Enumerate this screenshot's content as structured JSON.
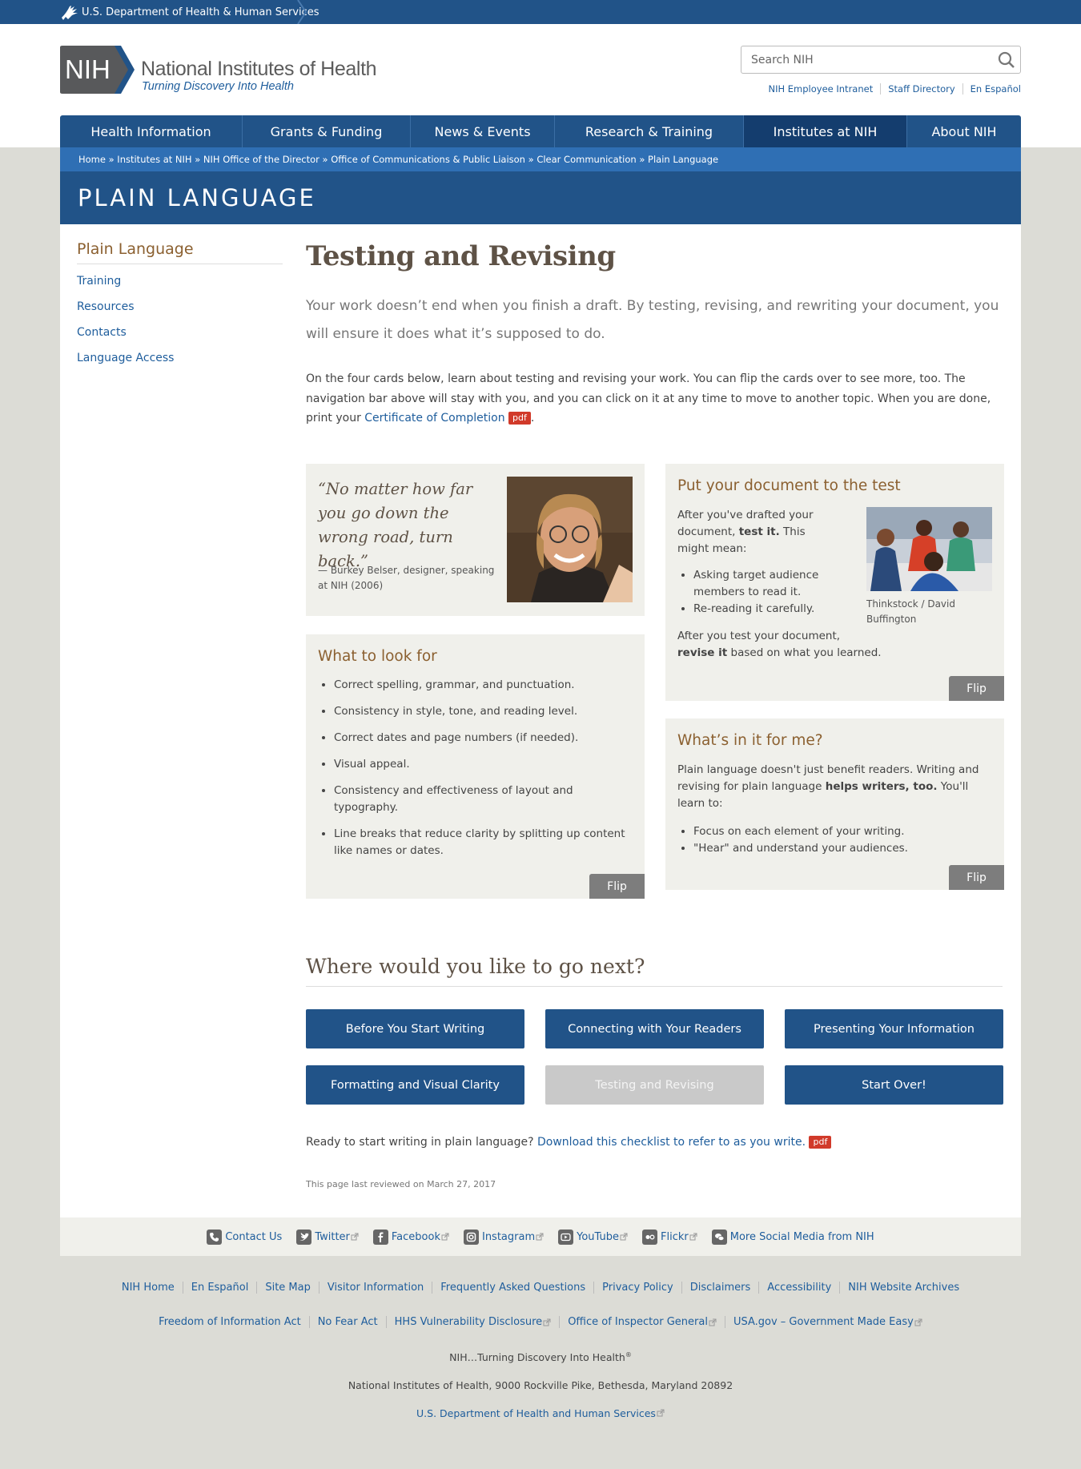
{
  "hhs": {
    "label": "U.S. Department of Health & Human Services"
  },
  "header": {
    "logo_abbr": "NIH",
    "logo_name": "National Institutes of Health",
    "logo_tagline": "Turning Discovery Into Health",
    "search_placeholder": "Search NIH",
    "util_links": [
      "NIH Employee Intranet",
      "Staff Directory",
      "En Español"
    ]
  },
  "nav": {
    "items": [
      "Health Information",
      "Grants & Funding",
      "News & Events",
      "Research & Training",
      "Institutes at NIH",
      "About NIH"
    ],
    "active": "Institutes at NIH"
  },
  "breadcrumb": "Home » Institutes at NIH » NIH Office of the Director » Office of Communications & Public Liaison » Clear Communication » Plain Language",
  "banner": {
    "title": "PLAIN LANGUAGE"
  },
  "sidebar": {
    "title": "Plain Language",
    "items": [
      "Training",
      "Resources",
      "Contacts",
      "Language Access"
    ]
  },
  "page": {
    "title": "Testing and Revising",
    "lead": "Your work doesn’t end when you finish a draft. By testing, revising, and rewriting your document, you will ensure it does what it’s supposed to do.",
    "intro_text": "On the four cards below, learn about testing and revising your work. You can flip the cards over to see more, too. The navigation bar above will stay with you, and you can click on it at any time to move to another topic. When you are done, print your ",
    "intro_link": "Certificate of Completion",
    "pdf_badge": "pdf",
    "intro_end": "."
  },
  "cards": {
    "quote": {
      "text": "“No matter how far you go down the wrong road, turn back.”",
      "attribution": "— Burkey Belser, designer, speaking at NIH (2006)"
    },
    "test": {
      "title": "Put your document to the test",
      "p1_a": "After you've drafted your document, ",
      "p1_bold": "test it.",
      "p1_b": " This might mean:",
      "bullets": [
        "Asking target audience members to read it.",
        "Re-reading it carefully."
      ],
      "p2_a": "After you test your document, ",
      "p2_bold": "revise it",
      "p2_b": " based on what you learned.",
      "caption": "Thinkstock / David Buffington",
      "flip": "Flip"
    },
    "look": {
      "title": "What to look for",
      "bullets": [
        "Correct spelling, grammar, and punctuation.",
        "Consistency in style, tone, and reading level.",
        "Correct dates and page numbers (if needed).",
        "Visual appeal.",
        "Consistency and effectiveness of layout and typography.",
        "Line breaks that reduce clarity by splitting up content like names or dates."
      ],
      "flip": "Flip"
    },
    "me": {
      "title": "What’s in it for me?",
      "p1_a": "Plain language doesn't just benefit readers. Writing and revising for plain language ",
      "p1_bold": "helps writers, too.",
      "p1_b": " You'll learn to:",
      "bullets": [
        "Focus on each element of your writing.",
        "\"Hear\" and understand your audiences."
      ],
      "flip": "Flip"
    }
  },
  "next": {
    "heading": "Where would you like to go next?",
    "buttons": [
      "Before You Start Writing",
      "Connecting with Your Readers",
      "Presenting Your Information",
      "Formatting and Visual Clarity",
      "Testing and Revising",
      "Start Over!"
    ],
    "ready_text": "Ready to start writing in plain language? ",
    "ready_link": "Download this checklist to refer to as you write.",
    "pdf_badge": "pdf",
    "reviewed": "This page last reviewed on March 27, 2017"
  },
  "social": {
    "items": [
      "Contact Us",
      "Twitter",
      "Facebook",
      "Instagram",
      "YouTube",
      "Flickr",
      "More Social Media from NIH"
    ]
  },
  "footer": {
    "row1": [
      "NIH Home",
      "En Español",
      "Site Map",
      "Visitor Information",
      "Frequently Asked Questions",
      "Privacy Policy",
      "Disclaimers",
      "Accessibility",
      "NIH Website Archives"
    ],
    "row2": [
      "Freedom of Information Act",
      "No Fear Act",
      "HHS Vulnerability Disclosure",
      "Office of Inspector General",
      "USA.gov – Government Made Easy"
    ],
    "tagline": "NIH…Turning Discovery Into Health",
    "tagline_mark": "®",
    "address": "National Institutes of Health, 9000 Rockville Pike, Bethesda, Maryland 20892",
    "hhs_link": "U.S. Department of Health and Human Services"
  },
  "colors": {
    "brand_blue": "#215388",
    "link_blue": "#1e5d9c",
    "accent_brown": "#8b6030",
    "pdf_red": "#d13a2a"
  }
}
